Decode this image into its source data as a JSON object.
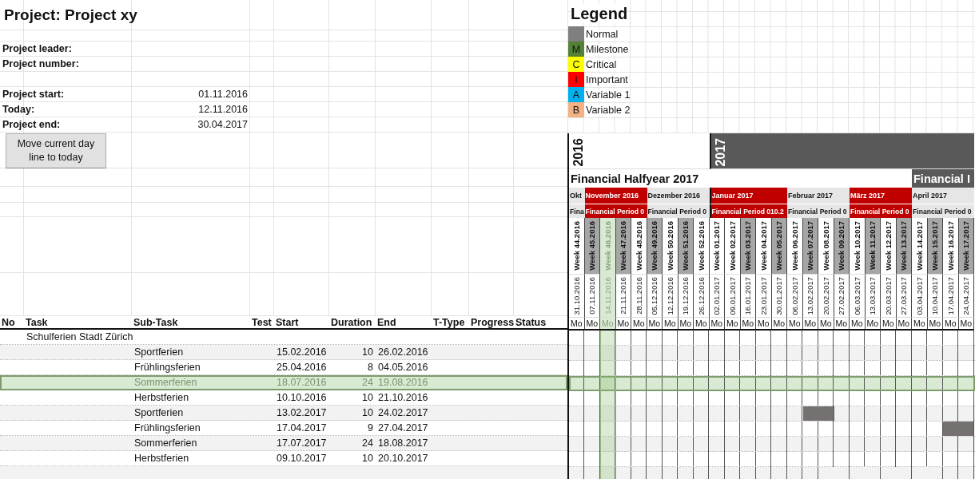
{
  "project": {
    "title": "Project: Project xy",
    "field_groups": [
      [
        {
          "label": "Project leader:"
        },
        {
          "label": "Project number:"
        }
      ],
      [
        {
          "label": "Project start:",
          "value": "01.11.2016"
        },
        {
          "label": "Today:",
          "value": "12.11.2016"
        },
        {
          "label": "Project end:",
          "value": "30.04.2017"
        }
      ]
    ]
  },
  "button": "Move current day line to today",
  "legend": {
    "title": "Legend",
    "items": [
      {
        "label": "Normal",
        "color": "#7f7f7f"
      },
      {
        "letter": "M",
        "label": "Milestone",
        "color": "#548235"
      },
      {
        "letter": "C",
        "label": "Critical",
        "color": "#ffff00"
      },
      {
        "letter": "I",
        "label": "Important",
        "color": "#ff0000"
      },
      {
        "letter": "A",
        "label": "Variable 1",
        "color": "#00b0f0"
      },
      {
        "letter": "B",
        "label": "Variable 2",
        "color": "#f4b183"
      }
    ]
  },
  "table": {
    "columns": [
      "No",
      "Task",
      "Sub-Task",
      "Test",
      "Start",
      "Duration",
      "End",
      "T-Type",
      "Progress",
      "Status"
    ],
    "groups": [
      {
        "task": "Schulferien Stadt Zürich",
        "rows": [
          {
            "sub_task": "Sportferien",
            "start": "15.02.2016",
            "duration": "10",
            "end": "26.02.2016",
            "selected": false
          },
          {
            "sub_task": "Frühlingsferien",
            "start": "25.04.2016",
            "duration": "8",
            "end": "04.05.2016",
            "selected": false
          },
          {
            "sub_task": "Sommerferien",
            "start": "18.07.2016",
            "duration": "24",
            "end": "19.08.2016",
            "selected": true
          },
          {
            "sub_task": "Herbstferien",
            "start": "10.10.2016",
            "duration": "10",
            "end": "21.10.2016",
            "selected": false
          },
          {
            "sub_task": "Sportferien",
            "start": "13.02.2017",
            "duration": "10",
            "end": "24.02.2017",
            "selected": false
          },
          {
            "sub_task": "Frühlingsferien",
            "start": "17.04.2017",
            "duration": "9",
            "end": "27.04.2017",
            "selected": false
          },
          {
            "sub_task": "Sommerferien",
            "start": "17.07.2017",
            "duration": "24",
            "end": "18.08.2017",
            "selected": false
          },
          {
            "sub_task": "Herbstferien",
            "start": "09.10.2017",
            "duration": "10",
            "end": "20.10.2017",
            "selected": false
          }
        ]
      }
    ]
  },
  "gantt": {
    "months": [
      {
        "label": "Okt",
        "period": "Fina",
        "highlighted": false,
        "year": {
          "label": "2016",
          "dark": false
        },
        "halfyear": {
          "label": "Financial Halfyear 2017",
          "dark": false
        },
        "weeks": [
          {
            "week": "Week 44.2016",
            "date": "31.10.2016",
            "day": "Mo",
            "shaded": false,
            "today": false
          }
        ]
      },
      {
        "label": "November 2016",
        "period": "Financial Period 0",
        "highlighted": true,
        "weeks": [
          {
            "week": "Week 45.2016",
            "date": "07.11.2016",
            "day": "Mo",
            "shaded": true,
            "today": false
          },
          {
            "week": "Week 46.2016",
            "date": "14.11.2016",
            "day": "Mo",
            "shaded": false,
            "today": true
          },
          {
            "week": "Week 47.2016",
            "date": "21.11.2016",
            "day": "Mo",
            "shaded": true,
            "today": false
          },
          {
            "week": "Week 48.2016",
            "date": "28.11.2016",
            "day": "Mo",
            "shaded": false,
            "today": false
          }
        ]
      },
      {
        "label": "Dezember 2016",
        "period": "Financial Period 0",
        "highlighted": false,
        "weeks": [
          {
            "week": "Week 49.2016",
            "date": "05.12.2016",
            "day": "Mo",
            "shaded": true,
            "today": false
          },
          {
            "week": "Week 50.2016",
            "date": "12.12.2016",
            "day": "Mo",
            "shaded": false,
            "today": false
          },
          {
            "week": "Week 51.2016",
            "date": "19.12.2016",
            "day": "Mo",
            "shaded": true,
            "today": false
          },
          {
            "week": "Week 52.2016",
            "date": "26.12.2016",
            "day": "Mo",
            "shaded": false,
            "today": false
          }
        ]
      },
      {
        "label": "Januar 2017",
        "period": "Financial Period 010.2",
        "highlighted": true,
        "year": {
          "label": "2017",
          "dark": true
        },
        "weeks": [
          {
            "week": "Week 01.2017",
            "date": "02.01.2017",
            "day": "Mo",
            "shaded": false,
            "today": false
          },
          {
            "week": "Week 02.2017",
            "date": "09.01.2017",
            "day": "Mo",
            "shaded": false,
            "today": false
          },
          {
            "week": "Week 03.2017",
            "date": "16.01.2017",
            "day": "Mo",
            "shaded": true,
            "today": false
          },
          {
            "week": "Week 04.2017",
            "date": "23.01.2017",
            "day": "Mo",
            "shaded": false,
            "today": false
          },
          {
            "week": "Week 05.2017",
            "date": "30.01.2017",
            "day": "Mo",
            "shaded": true,
            "today": false
          }
        ]
      },
      {
        "label": "Februar 2017",
        "period": "Financial Period 0",
        "highlighted": false,
        "weeks": [
          {
            "week": "Week 06.2017",
            "date": "06.02.2017",
            "day": "Mo",
            "shaded": false,
            "today": false
          },
          {
            "week": "Week 07.2017",
            "date": "13.02.2017",
            "day": "Mo",
            "shaded": true,
            "today": false
          },
          {
            "week": "Week 08.2017",
            "date": "20.02.2017",
            "day": "Mo",
            "shaded": false,
            "today": false
          },
          {
            "week": "Week 09.2017",
            "date": "27.02.2017",
            "day": "Mo",
            "shaded": true,
            "today": false
          }
        ]
      },
      {
        "label": "März 2017",
        "period": "Financial Period 0",
        "highlighted": true,
        "weeks": [
          {
            "week": "Week 10.2017",
            "date": "06.03.2017",
            "day": "Mo",
            "shaded": false,
            "today": false
          },
          {
            "week": "Week 11.2017",
            "date": "13.03.2017",
            "day": "Mo",
            "shaded": true,
            "today": false
          },
          {
            "week": "Week 12.2017",
            "date": "20.03.2017",
            "day": "Mo",
            "shaded": false,
            "today": false
          },
          {
            "week": "Week 13.2017",
            "date": "27.03.2017",
            "day": "Mo",
            "shaded": true,
            "today": false
          }
        ]
      },
      {
        "label": "April 2017",
        "period": "Financial Period 0",
        "highlighted": false,
        "halfyear": {
          "label": "Financial I",
          "dark": true
        },
        "weeks": [
          {
            "week": "Week 14.2017",
            "date": "03.04.2017",
            "day": "Mo",
            "shaded": false,
            "today": false
          },
          {
            "week": "Week 15.2017",
            "date": "10.04.2017",
            "day": "Mo",
            "shaded": true,
            "today": false
          },
          {
            "week": "Week 16.2017",
            "date": "17.04.2017",
            "day": "Mo",
            "shaded": false,
            "today": false
          },
          {
            "week": "Week 17.2017",
            "date": "24.04.2017",
            "day": "Mo",
            "shaded": true,
            "today": false
          }
        ]
      }
    ]
  }
}
